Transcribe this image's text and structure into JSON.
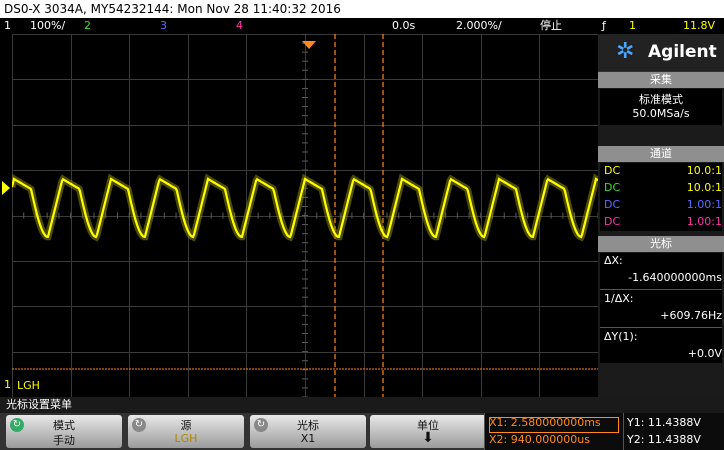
{
  "title": {
    "text": "DS0-X 3034A, MY54232144: Mon Nov 28 11:40:32 2016"
  },
  "status": {
    "ch1_num": "1",
    "ch1_scale": "100%/",
    "ch2_num": "2",
    "ch3_num": "3",
    "ch4_num": "4",
    "time_offset": "0.0s",
    "time_scale": "2.000%/",
    "run_state": "停止",
    "trigger_symbol": "ƒ",
    "trigger_channel": "1",
    "trigger_level": "11.8V"
  },
  "screen": {
    "ground_label": "LGH",
    "ground_channel": "1"
  },
  "sidebar": {
    "brand": "Agilent",
    "acquire_title": "采集",
    "acquire_mode": "标准模式",
    "acquire_rate": "50.0MSa/s",
    "channels_title": "通道",
    "channels": [
      {
        "coupling": "DC",
        "ratio": "10.0:1",
        "color": "#ffff00"
      },
      {
        "coupling": "DC",
        "ratio": "10.0:1",
        "color": "#33dd33"
      },
      {
        "coupling": "DC",
        "ratio": "1.00:1",
        "color": "#5a6cff"
      },
      {
        "coupling": "DC",
        "ratio": "1.00:1",
        "color": "#ff33aa"
      }
    ],
    "cursor_title": "光标",
    "dx_label": "ΔX:",
    "dx_value": "-1.640000000ms",
    "inv_dx_label": "1/ΔX:",
    "inv_dx_value": "+609.76Hz",
    "dy_label": "ΔY(1):",
    "dy_value": "+0.0V"
  },
  "menu": {
    "caption": "光标设置菜单",
    "softkeys": [
      {
        "top": "模式",
        "bottom": "手动"
      },
      {
        "top": "源",
        "bottom": "LGH"
      },
      {
        "top": "光标",
        "bottom": "X1"
      },
      {
        "top": "单位",
        "bottom": "⬇"
      }
    ]
  },
  "readouts": {
    "x1": "X1: 2.580000000ms",
    "x2": "X2: 940.000000us",
    "y1": "Y1: 11.4388V",
    "y2": "Y2: 11.4388V"
  },
  "colors": {
    "ch1": "#ffff00",
    "ch2": "#33dd33",
    "ch3": "#5a6cff",
    "ch4": "#ff33aa",
    "cursor": "#ff8a1a",
    "grid": "#3a3a3a"
  }
}
